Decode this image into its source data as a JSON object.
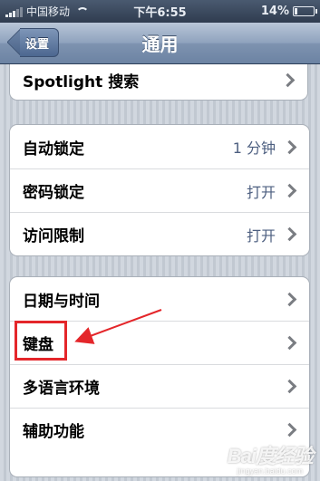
{
  "status_bar": {
    "carrier": "中国移动",
    "time": "下午6:55",
    "battery": "14%",
    "battery_level": 0.14
  },
  "nav": {
    "back_label": "设置",
    "title": "通用"
  },
  "group1": {
    "items": [
      {
        "label": "Spotlight 搜索"
      }
    ]
  },
  "group2": {
    "items": [
      {
        "label": "自动锁定",
        "value": "1 分钟"
      },
      {
        "label": "密码锁定",
        "value": "打开"
      },
      {
        "label": "访问限制",
        "value": "打开"
      }
    ]
  },
  "group3": {
    "items": [
      {
        "label": "日期与时间"
      },
      {
        "label": "键盘"
      },
      {
        "label": "多语言环境"
      },
      {
        "label": "辅助功能"
      }
    ]
  },
  "annotation": {
    "color": "#e4262a"
  },
  "watermark": {
    "logo": "Bai度经验",
    "sub": "jingyan.baidu.com"
  }
}
